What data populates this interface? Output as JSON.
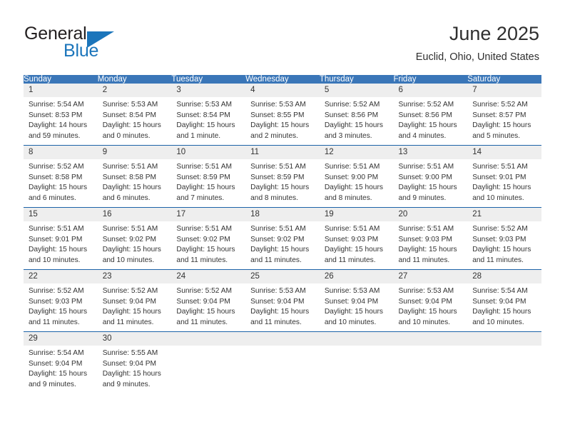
{
  "brand": {
    "name_top": "General",
    "name_bottom": "Blue",
    "accent_color": "#1b75bb"
  },
  "header": {
    "title": "June 2025",
    "location": "Euclid, Ohio, United States"
  },
  "theme": {
    "header_bg": "#3a76b8",
    "row_divider": "#1c63a8",
    "daynum_bg": "#eeeeee",
    "text": "#333333"
  },
  "weekday_headers": [
    "Sunday",
    "Monday",
    "Tuesday",
    "Wednesday",
    "Thursday",
    "Friday",
    "Saturday"
  ],
  "weeks": [
    [
      {
        "day": "1",
        "sunrise": "Sunrise: 5:54 AM",
        "sunset": "Sunset: 8:53 PM",
        "daylight_1": "Daylight: 14 hours",
        "daylight_2": "and 59 minutes."
      },
      {
        "day": "2",
        "sunrise": "Sunrise: 5:53 AM",
        "sunset": "Sunset: 8:54 PM",
        "daylight_1": "Daylight: 15 hours",
        "daylight_2": "and 0 minutes."
      },
      {
        "day": "3",
        "sunrise": "Sunrise: 5:53 AM",
        "sunset": "Sunset: 8:54 PM",
        "daylight_1": "Daylight: 15 hours",
        "daylight_2": "and 1 minute."
      },
      {
        "day": "4",
        "sunrise": "Sunrise: 5:53 AM",
        "sunset": "Sunset: 8:55 PM",
        "daylight_1": "Daylight: 15 hours",
        "daylight_2": "and 2 minutes."
      },
      {
        "day": "5",
        "sunrise": "Sunrise: 5:52 AM",
        "sunset": "Sunset: 8:56 PM",
        "daylight_1": "Daylight: 15 hours",
        "daylight_2": "and 3 minutes."
      },
      {
        "day": "6",
        "sunrise": "Sunrise: 5:52 AM",
        "sunset": "Sunset: 8:56 PM",
        "daylight_1": "Daylight: 15 hours",
        "daylight_2": "and 4 minutes."
      },
      {
        "day": "7",
        "sunrise": "Sunrise: 5:52 AM",
        "sunset": "Sunset: 8:57 PM",
        "daylight_1": "Daylight: 15 hours",
        "daylight_2": "and 5 minutes."
      }
    ],
    [
      {
        "day": "8",
        "sunrise": "Sunrise: 5:52 AM",
        "sunset": "Sunset: 8:58 PM",
        "daylight_1": "Daylight: 15 hours",
        "daylight_2": "and 6 minutes."
      },
      {
        "day": "9",
        "sunrise": "Sunrise: 5:51 AM",
        "sunset": "Sunset: 8:58 PM",
        "daylight_1": "Daylight: 15 hours",
        "daylight_2": "and 6 minutes."
      },
      {
        "day": "10",
        "sunrise": "Sunrise: 5:51 AM",
        "sunset": "Sunset: 8:59 PM",
        "daylight_1": "Daylight: 15 hours",
        "daylight_2": "and 7 minutes."
      },
      {
        "day": "11",
        "sunrise": "Sunrise: 5:51 AM",
        "sunset": "Sunset: 8:59 PM",
        "daylight_1": "Daylight: 15 hours",
        "daylight_2": "and 8 minutes."
      },
      {
        "day": "12",
        "sunrise": "Sunrise: 5:51 AM",
        "sunset": "Sunset: 9:00 PM",
        "daylight_1": "Daylight: 15 hours",
        "daylight_2": "and 8 minutes."
      },
      {
        "day": "13",
        "sunrise": "Sunrise: 5:51 AM",
        "sunset": "Sunset: 9:00 PM",
        "daylight_1": "Daylight: 15 hours",
        "daylight_2": "and 9 minutes."
      },
      {
        "day": "14",
        "sunrise": "Sunrise: 5:51 AM",
        "sunset": "Sunset: 9:01 PM",
        "daylight_1": "Daylight: 15 hours",
        "daylight_2": "and 10 minutes."
      }
    ],
    [
      {
        "day": "15",
        "sunrise": "Sunrise: 5:51 AM",
        "sunset": "Sunset: 9:01 PM",
        "daylight_1": "Daylight: 15 hours",
        "daylight_2": "and 10 minutes."
      },
      {
        "day": "16",
        "sunrise": "Sunrise: 5:51 AM",
        "sunset": "Sunset: 9:02 PM",
        "daylight_1": "Daylight: 15 hours",
        "daylight_2": "and 10 minutes."
      },
      {
        "day": "17",
        "sunrise": "Sunrise: 5:51 AM",
        "sunset": "Sunset: 9:02 PM",
        "daylight_1": "Daylight: 15 hours",
        "daylight_2": "and 11 minutes."
      },
      {
        "day": "18",
        "sunrise": "Sunrise: 5:51 AM",
        "sunset": "Sunset: 9:02 PM",
        "daylight_1": "Daylight: 15 hours",
        "daylight_2": "and 11 minutes."
      },
      {
        "day": "19",
        "sunrise": "Sunrise: 5:51 AM",
        "sunset": "Sunset: 9:03 PM",
        "daylight_1": "Daylight: 15 hours",
        "daylight_2": "and 11 minutes."
      },
      {
        "day": "20",
        "sunrise": "Sunrise: 5:51 AM",
        "sunset": "Sunset: 9:03 PM",
        "daylight_1": "Daylight: 15 hours",
        "daylight_2": "and 11 minutes."
      },
      {
        "day": "21",
        "sunrise": "Sunrise: 5:52 AM",
        "sunset": "Sunset: 9:03 PM",
        "daylight_1": "Daylight: 15 hours",
        "daylight_2": "and 11 minutes."
      }
    ],
    [
      {
        "day": "22",
        "sunrise": "Sunrise: 5:52 AM",
        "sunset": "Sunset: 9:03 PM",
        "daylight_1": "Daylight: 15 hours",
        "daylight_2": "and 11 minutes."
      },
      {
        "day": "23",
        "sunrise": "Sunrise: 5:52 AM",
        "sunset": "Sunset: 9:04 PM",
        "daylight_1": "Daylight: 15 hours",
        "daylight_2": "and 11 minutes."
      },
      {
        "day": "24",
        "sunrise": "Sunrise: 5:52 AM",
        "sunset": "Sunset: 9:04 PM",
        "daylight_1": "Daylight: 15 hours",
        "daylight_2": "and 11 minutes."
      },
      {
        "day": "25",
        "sunrise": "Sunrise: 5:53 AM",
        "sunset": "Sunset: 9:04 PM",
        "daylight_1": "Daylight: 15 hours",
        "daylight_2": "and 11 minutes."
      },
      {
        "day": "26",
        "sunrise": "Sunrise: 5:53 AM",
        "sunset": "Sunset: 9:04 PM",
        "daylight_1": "Daylight: 15 hours",
        "daylight_2": "and 10 minutes."
      },
      {
        "day": "27",
        "sunrise": "Sunrise: 5:53 AM",
        "sunset": "Sunset: 9:04 PM",
        "daylight_1": "Daylight: 15 hours",
        "daylight_2": "and 10 minutes."
      },
      {
        "day": "28",
        "sunrise": "Sunrise: 5:54 AM",
        "sunset": "Sunset: 9:04 PM",
        "daylight_1": "Daylight: 15 hours",
        "daylight_2": "and 10 minutes."
      }
    ],
    [
      {
        "day": "29",
        "sunrise": "Sunrise: 5:54 AM",
        "sunset": "Sunset: 9:04 PM",
        "daylight_1": "Daylight: 15 hours",
        "daylight_2": "and 9 minutes."
      },
      {
        "day": "30",
        "sunrise": "Sunrise: 5:55 AM",
        "sunset": "Sunset: 9:04 PM",
        "daylight_1": "Daylight: 15 hours",
        "daylight_2": "and 9 minutes."
      },
      {
        "day": "",
        "sunrise": "",
        "sunset": "",
        "daylight_1": "",
        "daylight_2": ""
      },
      {
        "day": "",
        "sunrise": "",
        "sunset": "",
        "daylight_1": "",
        "daylight_2": ""
      },
      {
        "day": "",
        "sunrise": "",
        "sunset": "",
        "daylight_1": "",
        "daylight_2": ""
      },
      {
        "day": "",
        "sunrise": "",
        "sunset": "",
        "daylight_1": "",
        "daylight_2": ""
      },
      {
        "day": "",
        "sunrise": "",
        "sunset": "",
        "daylight_1": "",
        "daylight_2": ""
      }
    ]
  ]
}
